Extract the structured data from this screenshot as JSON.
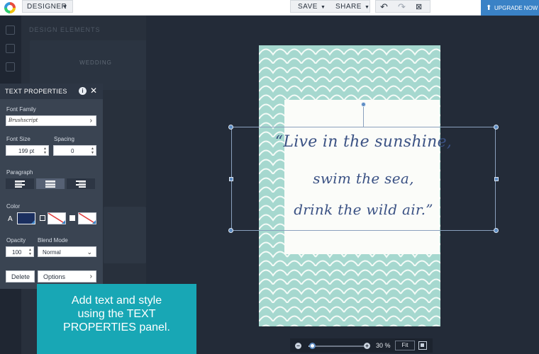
{
  "topbar": {
    "mode": "DESIGNER",
    "save_label": "SAVE",
    "share_label": "SHARE",
    "upgrade_label": "UPGRADE NOW"
  },
  "elements_panel": {
    "title": "DESIGN ELEMENTS",
    "tiles": [
      {
        "label": "WEDDING"
      }
    ]
  },
  "text_properties": {
    "title": "TEXT PROPERTIES",
    "font_family_label": "Font Family",
    "font_family_value": "Brushscript",
    "font_size_label": "Font Size",
    "font_size_value": "199 pt",
    "spacing_label": "Spacing",
    "spacing_value": "0",
    "paragraph_label": "Paragraph",
    "alignment_selected": "center",
    "color_label": "Color",
    "color_text_glyph": "A",
    "text_color": "#1b2f5f",
    "opacity_label": "Opacity",
    "opacity_value": "100",
    "blend_mode_label": "Blend Mode",
    "blend_mode_value": "Normal",
    "delete_label": "Delete",
    "options_label": "Options"
  },
  "callout": {
    "text_line1": "Add text and style",
    "text_line2": "using the TEXT",
    "text_line3": "PROPERTIES panel."
  },
  "canvas": {
    "background_color": "#a6d8cf",
    "card_color": "#fbfcf9",
    "quote_lines": [
      "“Live in the sunshine,",
      "swim the sea,",
      "drink the wild air.”"
    ]
  },
  "zoom": {
    "value_label": "30 %",
    "fit_label": "Fit",
    "level_fraction": 0.3
  },
  "colors": {
    "accent": "#3a82c6",
    "callout": "#18a7b5",
    "quote_ink": "#3b5284"
  }
}
